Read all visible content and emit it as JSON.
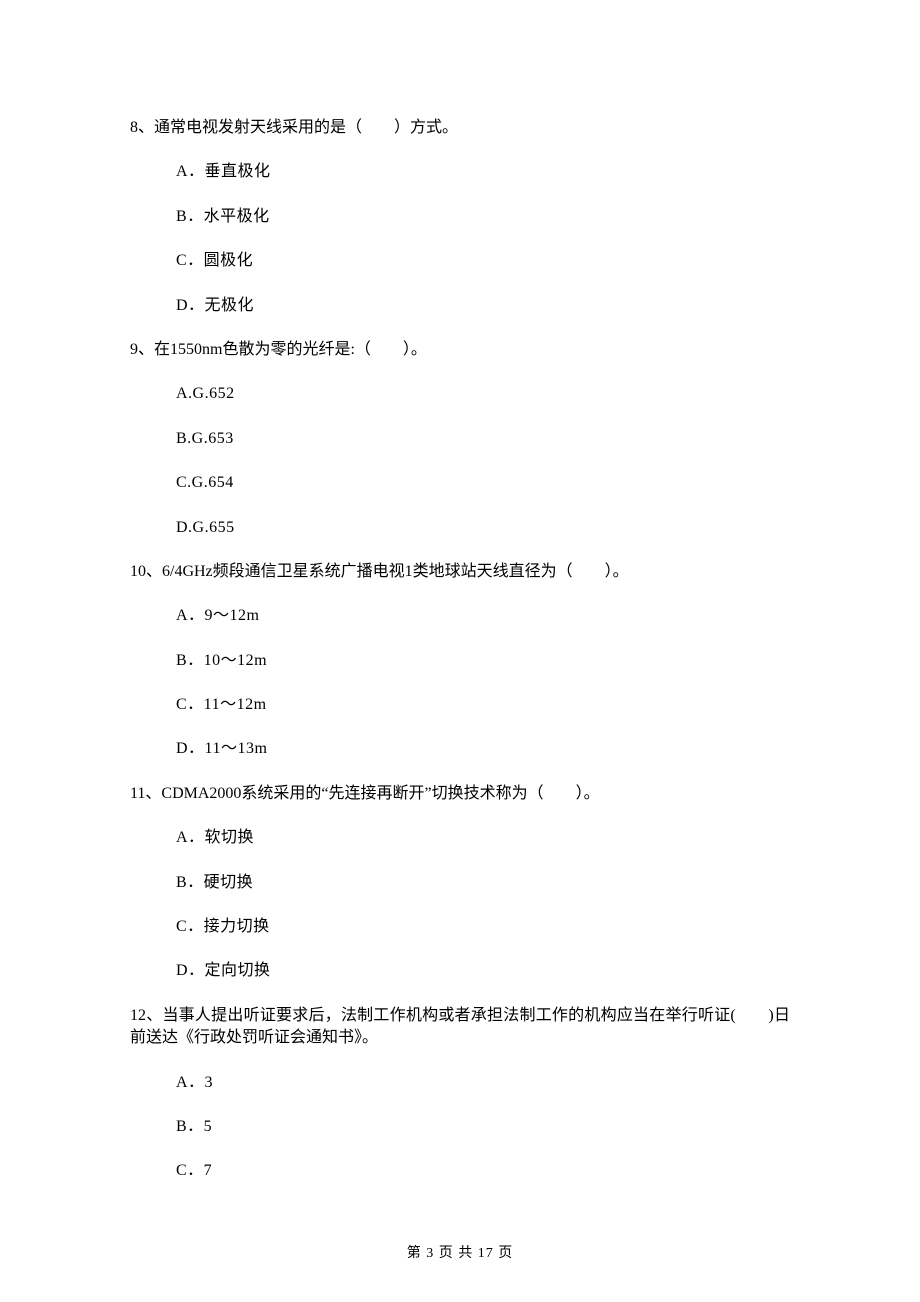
{
  "questions": [
    {
      "stem": "8、通常电视发射天线采用的是（　　）方式。",
      "options": [
        "A．垂直极化",
        "B．水平极化",
        "C．圆极化",
        "D．无极化"
      ]
    },
    {
      "stem": "9、在1550nm色散为零的光纤是:（　　）。",
      "options": [
        "A.G.652",
        "B.G.653",
        "C.G.654",
        "D.G.655"
      ]
    },
    {
      "stem": "10、6/4GHz频段通信卫星系统广播电视1类地球站天线直径为（　　）。",
      "options": [
        "A．9～12m",
        "B．10～12m",
        "C．11～12m",
        "D．11～13m"
      ]
    },
    {
      "stem": "11、CDMA2000系统采用的“先连接再断开”切换技术称为（　　）。",
      "options": [
        "A．软切换",
        "B．硬切换",
        "C．接力切换",
        "D．定向切换"
      ]
    },
    {
      "stem": "12、当事人提出听证要求后，法制工作机构或者承担法制工作的机构应当在举行听证(　　)日前送达《行政处罚听证会通知书》。",
      "options": [
        "A．3",
        "B．5",
        "C．7"
      ]
    }
  ],
  "footer": "第 3 页 共 17 页"
}
